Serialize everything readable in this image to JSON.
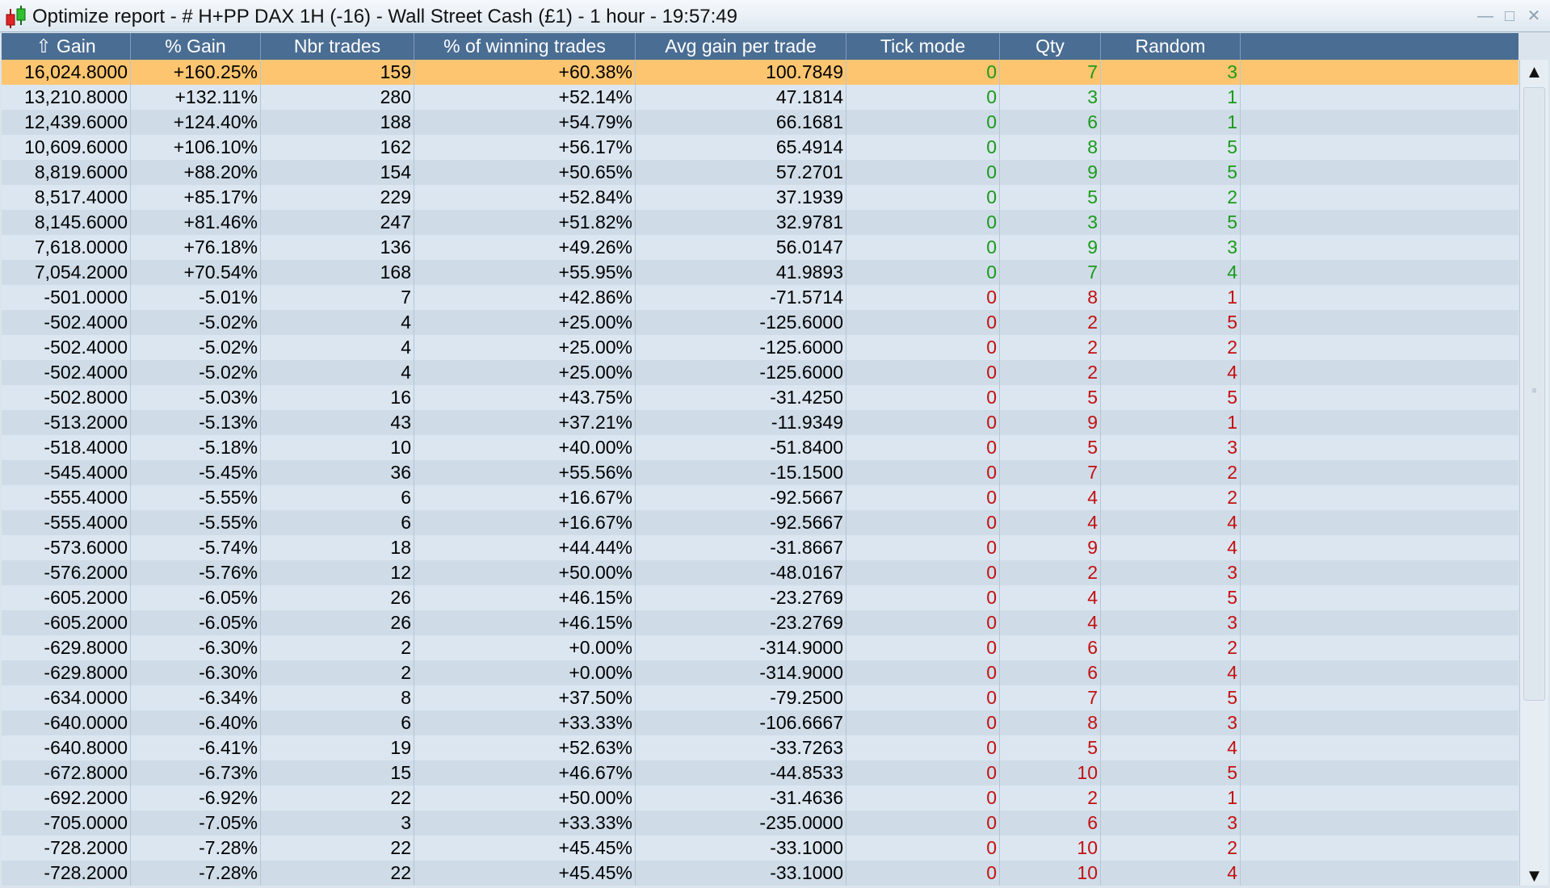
{
  "window": {
    "title": "Optimize report - # H+PP DAX 1H (-16) - Wall Street Cash (£1) - 1 hour - 19:57:49",
    "icons": {
      "app": "candlestick-chart-icon",
      "minimize": "minimize-icon",
      "maximize": "maximize-icon",
      "close": "close-icon"
    }
  },
  "colors": {
    "header_bg": "#4a6d93",
    "selected_row": "#fdc56f",
    "positive": "#1a9a1a",
    "negative": "#c21010"
  },
  "table": {
    "columns": [
      "Gain",
      "% Gain",
      "Nbr trades",
      "% of winning trades",
      "Avg gain per trade",
      "Tick mode",
      "Qty",
      "Random"
    ],
    "sort_indicator": "⇧",
    "selected_row": 0,
    "rows": [
      [
        "16,024.8000",
        "+160.25%",
        "159",
        "+60.38%",
        "100.7849",
        "0",
        "7",
        "3"
      ],
      [
        "13,210.8000",
        "+132.11%",
        "280",
        "+52.14%",
        "47.1814",
        "0",
        "3",
        "1"
      ],
      [
        "12,439.6000",
        "+124.40%",
        "188",
        "+54.79%",
        "66.1681",
        "0",
        "6",
        "1"
      ],
      [
        "10,609.6000",
        "+106.10%",
        "162",
        "+56.17%",
        "65.4914",
        "0",
        "8",
        "5"
      ],
      [
        "8,819.6000",
        "+88.20%",
        "154",
        "+50.65%",
        "57.2701",
        "0",
        "9",
        "5"
      ],
      [
        "8,517.4000",
        "+85.17%",
        "229",
        "+52.84%",
        "37.1939",
        "0",
        "5",
        "2"
      ],
      [
        "8,145.6000",
        "+81.46%",
        "247",
        "+51.82%",
        "32.9781",
        "0",
        "3",
        "5"
      ],
      [
        "7,618.0000",
        "+76.18%",
        "136",
        "+49.26%",
        "56.0147",
        "0",
        "9",
        "3"
      ],
      [
        "7,054.2000",
        "+70.54%",
        "168",
        "+55.95%",
        "41.9893",
        "0",
        "7",
        "4"
      ],
      [
        "-501.0000",
        "-5.01%",
        "7",
        "+42.86%",
        "-71.5714",
        "0",
        "8",
        "1"
      ],
      [
        "-502.4000",
        "-5.02%",
        "4",
        "+25.00%",
        "-125.6000",
        "0",
        "2",
        "5"
      ],
      [
        "-502.4000",
        "-5.02%",
        "4",
        "+25.00%",
        "-125.6000",
        "0",
        "2",
        "2"
      ],
      [
        "-502.4000",
        "-5.02%",
        "4",
        "+25.00%",
        "-125.6000",
        "0",
        "2",
        "4"
      ],
      [
        "-502.8000",
        "-5.03%",
        "16",
        "+43.75%",
        "-31.4250",
        "0",
        "5",
        "5"
      ],
      [
        "-513.2000",
        "-5.13%",
        "43",
        "+37.21%",
        "-11.9349",
        "0",
        "9",
        "1"
      ],
      [
        "-518.4000",
        "-5.18%",
        "10",
        "+40.00%",
        "-51.8400",
        "0",
        "5",
        "3"
      ],
      [
        "-545.4000",
        "-5.45%",
        "36",
        "+55.56%",
        "-15.1500",
        "0",
        "7",
        "2"
      ],
      [
        "-555.4000",
        "-5.55%",
        "6",
        "+16.67%",
        "-92.5667",
        "0",
        "4",
        "2"
      ],
      [
        "-555.4000",
        "-5.55%",
        "6",
        "+16.67%",
        "-92.5667",
        "0",
        "4",
        "4"
      ],
      [
        "-573.6000",
        "-5.74%",
        "18",
        "+44.44%",
        "-31.8667",
        "0",
        "9",
        "4"
      ],
      [
        "-576.2000",
        "-5.76%",
        "12",
        "+50.00%",
        "-48.0167",
        "0",
        "2",
        "3"
      ],
      [
        "-605.2000",
        "-6.05%",
        "26",
        "+46.15%",
        "-23.2769",
        "0",
        "4",
        "5"
      ],
      [
        "-605.2000",
        "-6.05%",
        "26",
        "+46.15%",
        "-23.2769",
        "0",
        "4",
        "3"
      ],
      [
        "-629.8000",
        "-6.30%",
        "2",
        "+0.00%",
        "-314.9000",
        "0",
        "6",
        "2"
      ],
      [
        "-629.8000",
        "-6.30%",
        "2",
        "+0.00%",
        "-314.9000",
        "0",
        "6",
        "4"
      ],
      [
        "-634.0000",
        "-6.34%",
        "8",
        "+37.50%",
        "-79.2500",
        "0",
        "7",
        "5"
      ],
      [
        "-640.0000",
        "-6.40%",
        "6",
        "+33.33%",
        "-106.6667",
        "0",
        "8",
        "3"
      ],
      [
        "-640.8000",
        "-6.41%",
        "19",
        "+52.63%",
        "-33.7263",
        "0",
        "5",
        "4"
      ],
      [
        "-672.8000",
        "-6.73%",
        "15",
        "+46.67%",
        "-44.8533",
        "0",
        "10",
        "5"
      ],
      [
        "-692.2000",
        "-6.92%",
        "22",
        "+50.00%",
        "-31.4636",
        "0",
        "2",
        "1"
      ],
      [
        "-705.0000",
        "-7.05%",
        "3",
        "+33.33%",
        "-235.0000",
        "0",
        "6",
        "3"
      ],
      [
        "-728.2000",
        "-7.28%",
        "22",
        "+45.45%",
        "-33.1000",
        "0",
        "10",
        "2"
      ],
      [
        "-728.2000",
        "-7.28%",
        "22",
        "+45.45%",
        "-33.1000",
        "0",
        "10",
        "4"
      ]
    ]
  },
  "scrollbar": {
    "up_icon": "▲",
    "down_icon": "▼",
    "grip": "≡"
  }
}
